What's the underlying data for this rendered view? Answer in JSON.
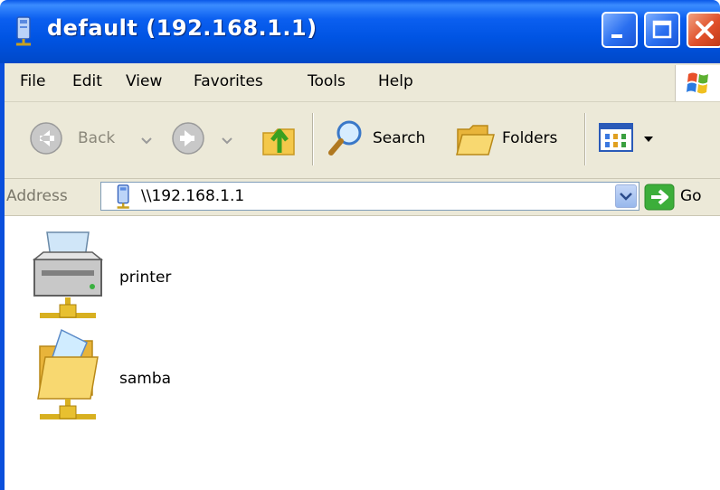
{
  "window": {
    "title": "default (192.168.1.1)",
    "controls": {
      "minimize": "minimize",
      "maximize": "maximize",
      "close": "close"
    }
  },
  "menubar": {
    "items": [
      {
        "label": "File"
      },
      {
        "label": "Edit"
      },
      {
        "label": "View"
      },
      {
        "label": "Favorites"
      },
      {
        "label": "Tools"
      },
      {
        "label": "Help"
      }
    ]
  },
  "toolbar": {
    "back_label": "Back",
    "search_label": "Search",
    "folders_label": "Folders"
  },
  "address": {
    "label": "Address",
    "value": "\\\\192.168.1.1",
    "go_label": "Go"
  },
  "content": {
    "items": [
      {
        "label": "printer",
        "icon": "network-printer-icon"
      },
      {
        "label": "samba",
        "icon": "shared-folder-icon"
      }
    ]
  },
  "colors": {
    "titlebar": "#0054e3",
    "chrome": "#ece9d8",
    "close_button": "#e0502a"
  }
}
